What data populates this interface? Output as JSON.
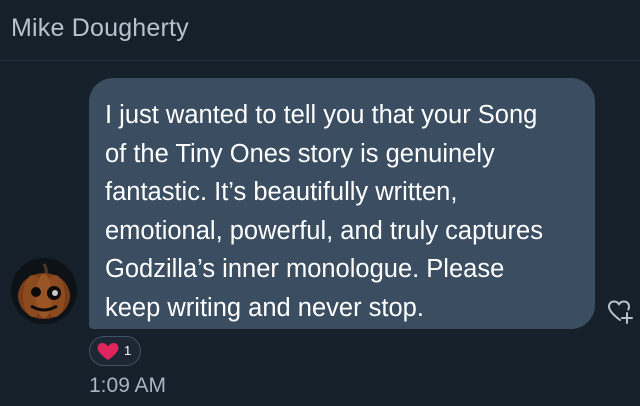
{
  "header": {
    "sender_name": "Mike Dougherty"
  },
  "message": {
    "text": "I just wanted to tell you that your Song\nof the Tiny Ones story is genuinely\nfantastic. It’s beautifully written,\nemotional, powerful, and truly captures\nGodzilla’s  inner monologue. Please\nkeep writing and never stop.",
    "timestamp": "1:09 AM"
  },
  "reaction": {
    "icon": "heart-icon",
    "count": "1",
    "color": "#e0245e"
  },
  "colors": {
    "background": "#15202b",
    "bubble": "#3a4d61",
    "text": "#ffffff",
    "muted": "#a8b4bf"
  }
}
